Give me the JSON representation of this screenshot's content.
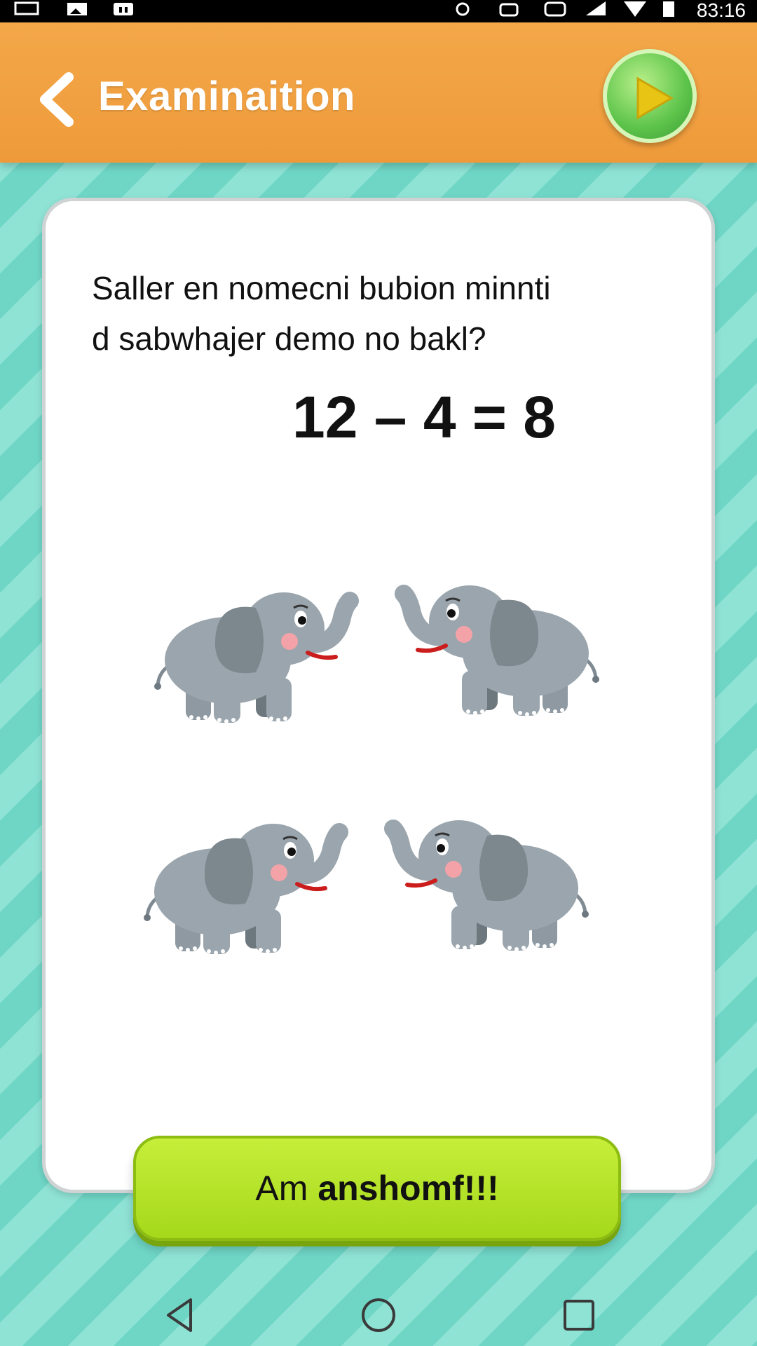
{
  "status_bar": {
    "time": "83:16",
    "icons": [
      "window-icon",
      "photo-icon",
      "app-icon",
      "sync-icon",
      "alarm-icon",
      "cast-icon",
      "signal-icon",
      "wifi-icon",
      "battery-icon"
    ]
  },
  "header": {
    "title": "Examinaition",
    "back_icon": "chevron-left-icon",
    "play_icon": "play-icon"
  },
  "question": {
    "text_line1": "Saller en nomecni bubion minnti",
    "text_line2": "d sabwhajer demo no bakl?",
    "equation": "12 – 4 = 8",
    "elephant_count": 4
  },
  "answer_button": {
    "label_plain": "Am",
    "label_bold": "anshomf!!!"
  },
  "navigation": {
    "back_icon": "nav-back-icon",
    "home_icon": "nav-home-icon",
    "recents_icon": "nav-recents-icon"
  },
  "colors": {
    "header": "#f4a849",
    "background": "#6fd6c6",
    "answer_button": "#b8e62a",
    "play_button": "#5cc34a"
  }
}
